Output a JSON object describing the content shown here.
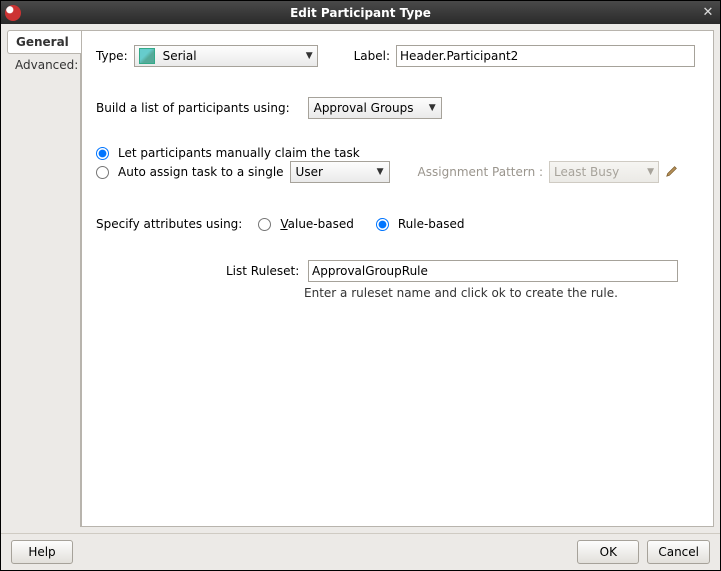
{
  "titlebar": {
    "title": "Edit Participant Type"
  },
  "sidebar": {
    "tabs": [
      {
        "label": "General",
        "active": true
      },
      {
        "label": "Advanced:",
        "active": false
      }
    ]
  },
  "panel": {
    "type_label": "Type:",
    "type_value": "Serial",
    "label_label": "Label:",
    "label_value": "Header.Participant2",
    "build_label": "Build a list of participants using:",
    "build_value": "Approval Groups",
    "claim_option": "Let participants manually claim the task",
    "auto_option": "Auto assign task to a single",
    "auto_target": "User",
    "assign_pattern_label": "Assignment Pattern :",
    "assign_pattern_value": "Least Busy",
    "attr_label": "Specify attributes using:",
    "attr_value_based": "Value-based",
    "attr_rule_based": "Rule-based",
    "ruleset_label": "List Ruleset:",
    "ruleset_value": "ApprovalGroupRule",
    "ruleset_hint": "Enter a ruleset name and click ok to create the rule."
  },
  "footer": {
    "help": "Help",
    "ok": "OK",
    "cancel": "Cancel"
  }
}
